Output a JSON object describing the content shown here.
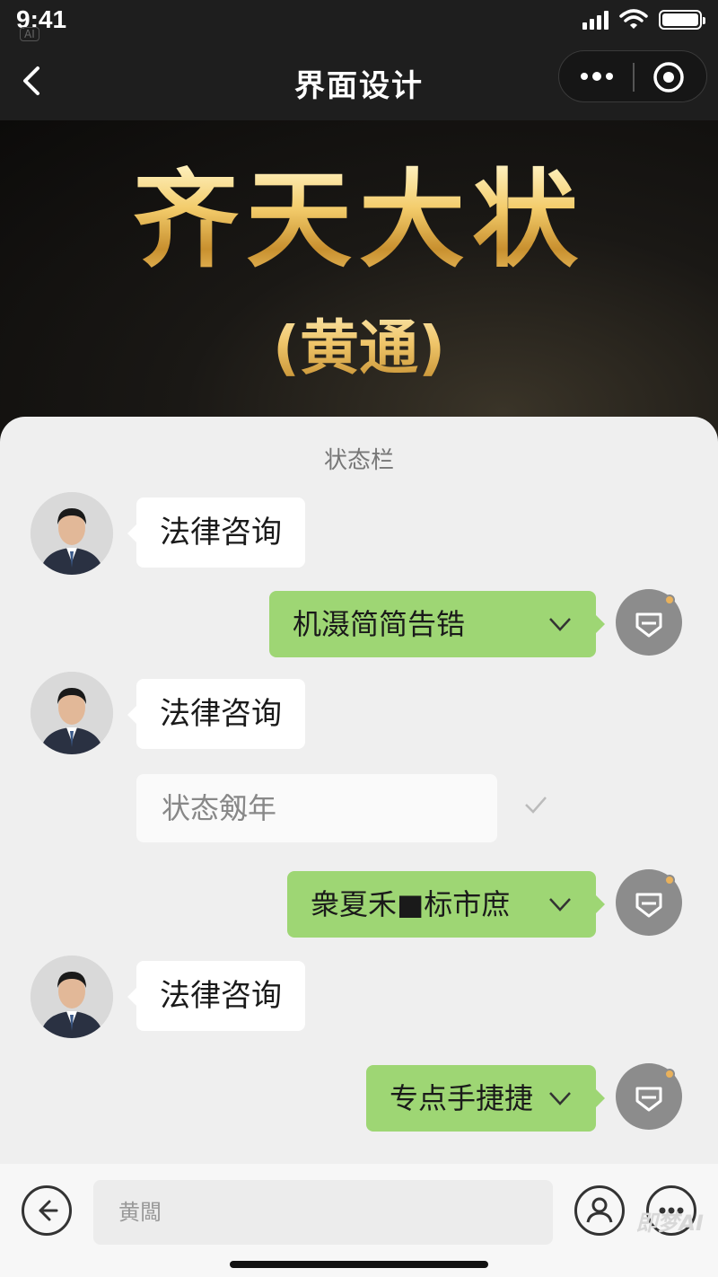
{
  "status_bar": {
    "time": "9:41",
    "ai_tag": "AI"
  },
  "nav": {
    "title": "界面设计"
  },
  "banner": {
    "title": "齐天大状",
    "subtitle": "(黄通)"
  },
  "chat": {
    "sheet_title": "状态栏",
    "messages": [
      {
        "side": "left",
        "text": "法律咨询"
      },
      {
        "side": "right",
        "text": "机滠简简告锆"
      },
      {
        "side": "left",
        "text": "法律咨询"
      },
      {
        "side": "center",
        "text": "状态剱年"
      },
      {
        "side": "right",
        "text": "衆夏禾■标市庶"
      },
      {
        "side": "left",
        "text": "法律咨询"
      },
      {
        "side": "right",
        "text": "专点手捷捷"
      }
    ]
  },
  "input": {
    "placeholder": "黄闆"
  },
  "watermark": "即梦AI",
  "colors": {
    "green_bubble": "#9ed674",
    "gold": "#e3b95a",
    "sheet_bg": "#efefef"
  }
}
